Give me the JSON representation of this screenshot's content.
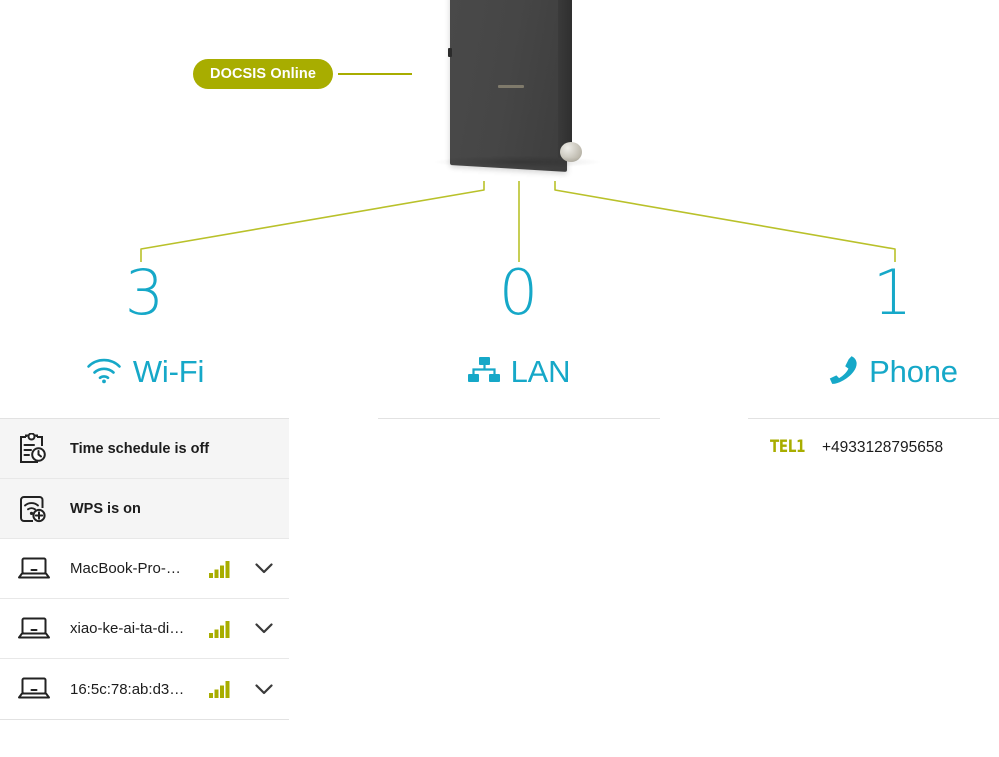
{
  "colors": {
    "accent_cyan": "#16a8c8",
    "accent_olive": "#a8ad00",
    "text_dark": "#1c1c1c",
    "row_status_bg": "#f5f5f5",
    "divider": "#e2e2e2"
  },
  "status_pill": {
    "label": "DOCSIS Online",
    "icon": "status-pill"
  },
  "device": {
    "icon": "router-modem-illustration"
  },
  "columns": [
    {
      "id": "wifi",
      "count": "3",
      "label": "Wi-Fi",
      "icon": "wifi-icon"
    },
    {
      "id": "lan",
      "count": "0",
      "label": "LAN",
      "icon": "lan-network-icon"
    },
    {
      "id": "phone",
      "count": "1",
      "label": "Phone",
      "icon": "phone-handset-icon"
    }
  ],
  "wifi_panel": {
    "status_rows": [
      {
        "icon": "time-schedule-icon",
        "label": "Time schedule is off"
      },
      {
        "icon": "wps-icon",
        "label": "WPS is on"
      }
    ],
    "devices": [
      {
        "icon": "laptop-icon",
        "name": "MacBook-Pro-…",
        "signal": "signal-bars-4",
        "signal_level": 4,
        "expand": "chevron-down-icon"
      },
      {
        "icon": "laptop-icon",
        "name": "xiao-ke-ai-ta-di…",
        "signal": "signal-bars-4",
        "signal_level": 4,
        "expand": "chevron-down-icon"
      },
      {
        "icon": "laptop-icon",
        "name": "16:5c:78:ab:d3…",
        "signal": "signal-bars-4",
        "signal_level": 4,
        "expand": "chevron-down-icon"
      }
    ]
  },
  "phone_panel": {
    "lines": [
      {
        "label": "TEL1",
        "number": "+4933128795658"
      }
    ]
  }
}
